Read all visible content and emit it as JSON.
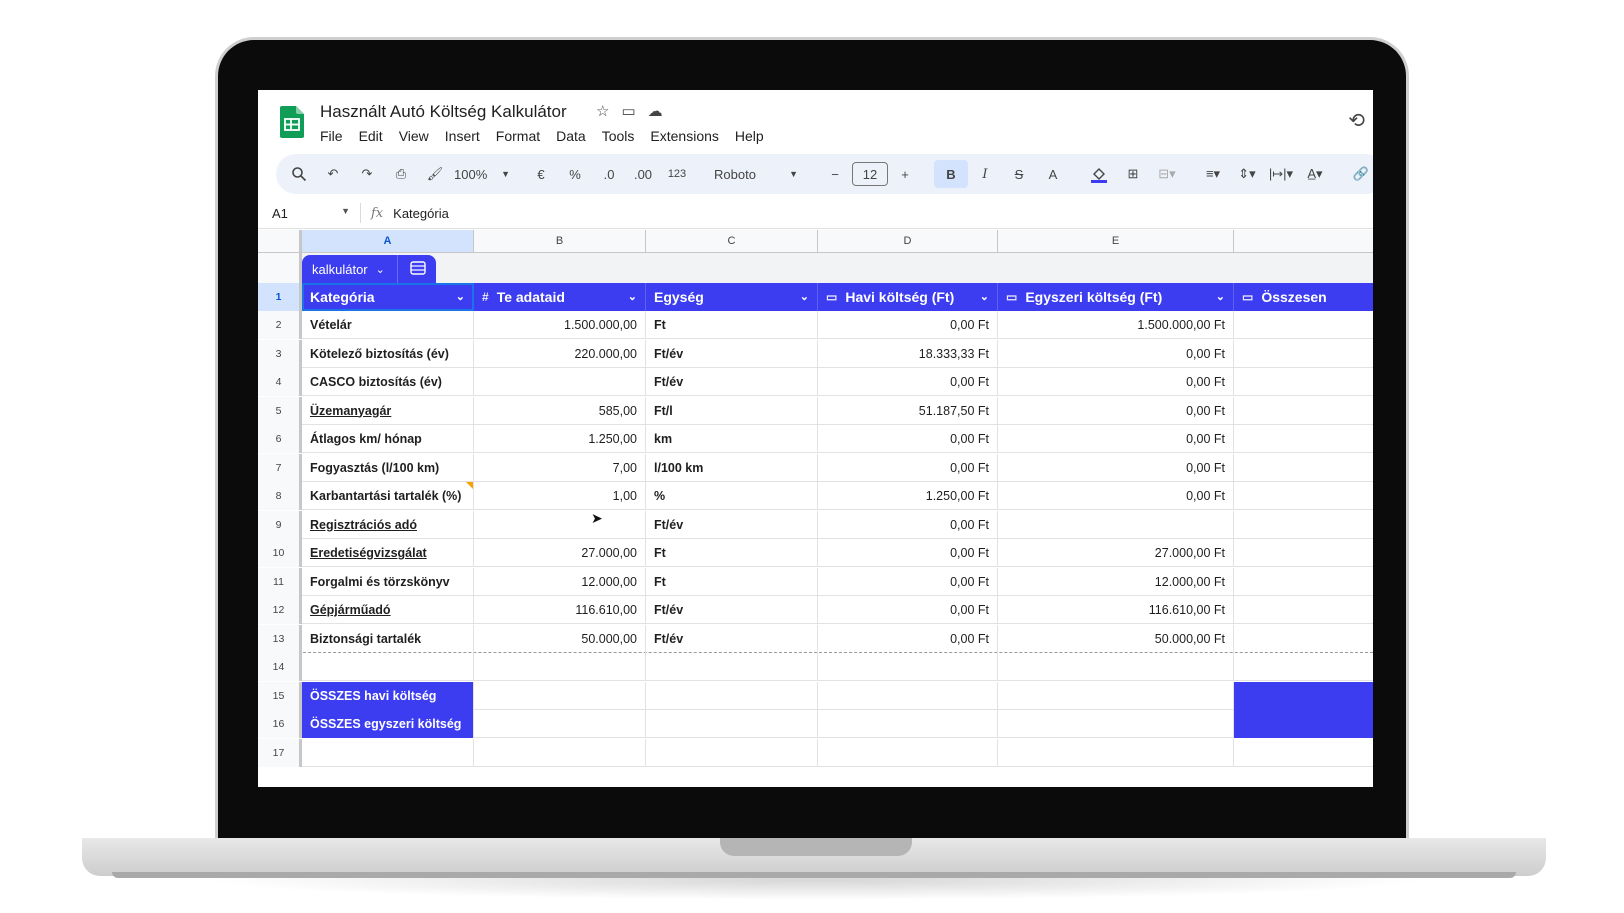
{
  "app": {
    "title": "Használt Autó Költség Kalkulátor",
    "menu": [
      "File",
      "Edit",
      "View",
      "Insert",
      "Format",
      "Data",
      "Tools",
      "Extensions",
      "Help"
    ]
  },
  "toolbar": {
    "zoom": "100%",
    "currency": "€",
    "percent": "%",
    "dec_decrease": ".0",
    "dec_increase": ".00",
    "number_format": "123",
    "font": "Roboto",
    "font_size": "12",
    "minus": "−",
    "plus": "+",
    "bold": "B",
    "italic": "I",
    "strike": "S",
    "text_color": "A"
  },
  "formula_bar": {
    "cell_ref": "A1",
    "fx": "fx",
    "content": "Kategória"
  },
  "columns": [
    "A",
    "B",
    "C",
    "D",
    "E"
  ],
  "table_chip": {
    "name": "kalkulátor"
  },
  "header": {
    "row_num": "1",
    "col_a": "Kategória",
    "col_b_icon": "#",
    "col_b": "Te adataid",
    "col_c": "Egység",
    "col_d": "Havi költség (Ft)",
    "col_e": "Egyszeri költség (Ft)",
    "col_f": "Összesen"
  },
  "rows": [
    {
      "n": "2",
      "a": "Vételár",
      "b": "1.500.000,00",
      "c": "Ft",
      "d": "0,00 Ft",
      "e": "1.500.000,00 Ft"
    },
    {
      "n": "3",
      "a": "Kötelező biztosítás (év)",
      "b": "220.000,00",
      "c": "Ft/év",
      "d": "18.333,33 Ft",
      "e": "0,00 Ft"
    },
    {
      "n": "4",
      "a": "CASCO biztosítás (év)",
      "b": "",
      "c": "Ft/év",
      "d": "0,00 Ft",
      "e": "0,00 Ft"
    },
    {
      "n": "5",
      "a": "Üzemanyagár",
      "b": "585,00",
      "c": "Ft/l",
      "d": "51.187,50 Ft",
      "e": "0,00 Ft"
    },
    {
      "n": "6",
      "a": "Átlagos km/ hónap",
      "b": "1.250,00",
      "c": "km",
      "d": "0,00 Ft",
      "e": "0,00 Ft"
    },
    {
      "n": "7",
      "a": "Fogyasztás (l/100 km)",
      "b": "7,00",
      "c": "l/100 km",
      "d": "0,00 Ft",
      "e": "0,00 Ft"
    },
    {
      "n": "8",
      "a": "Karbantartási tartalék (%)",
      "b": "1,00",
      "c": "%",
      "d": "1.250,00 Ft",
      "e": "0,00 Ft"
    },
    {
      "n": "9",
      "a": "Regisztrációs adó",
      "b": "",
      "c": "Ft/év",
      "d": "0,00 Ft",
      "e": ""
    },
    {
      "n": "10",
      "a": "Eredetiségvizsgálat",
      "b": "27.000,00",
      "c": "Ft",
      "d": "0,00 Ft",
      "e": "27.000,00 Ft"
    },
    {
      "n": "11",
      "a": "Forgalmi és törzskönyv",
      "b": "12.000,00",
      "c": "Ft",
      "d": "0,00 Ft",
      "e": "12.000,00 Ft"
    },
    {
      "n": "12",
      "a": "Gépjárműadó",
      "b": "116.610,00",
      "c": "Ft/év",
      "d": "0,00 Ft",
      "e": "116.610,00 Ft"
    },
    {
      "n": "13",
      "a": "Biztonsági tartalék",
      "b": "50.000,00",
      "c": "Ft/év",
      "d": "0,00 Ft",
      "e": "50.000,00 Ft"
    }
  ],
  "empty_rows": [
    "14",
    "17"
  ],
  "totals": [
    {
      "n": "15",
      "a": "ÖSSZES havi költség"
    },
    {
      "n": "16",
      "a": "ÖSSZES egyszeri költség"
    }
  ],
  "colors": {
    "table_header": "#3c3cf0",
    "selection": "#d3e3fd",
    "toolbar_bg": "#edf2fa",
    "sheets_green": "#0f9d58"
  },
  "icons": [
    "sheets-logo",
    "star-icon",
    "move-folder-icon",
    "cloud-status-icon",
    "history-icon",
    "search-icon",
    "undo-icon",
    "redo-icon",
    "print-icon",
    "paint-format-icon",
    "fill-color-icon",
    "borders-icon",
    "merge-cells-icon",
    "align-icon",
    "valign-icon",
    "text-wrap-icon",
    "text-rotate-icon",
    "link-icon",
    "comment-icon",
    "table-settings-icon",
    "cursor-icon"
  ]
}
